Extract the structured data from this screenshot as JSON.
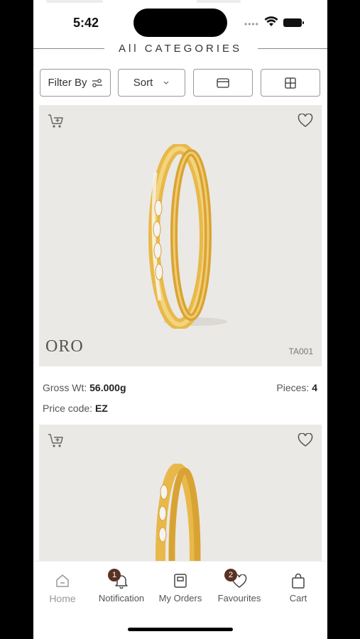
{
  "status_bar": {
    "time": "5:42"
  },
  "header": {
    "title": "All CATEGORIES"
  },
  "toolbar": {
    "filter_label": "Filter By",
    "sort_label": "Sort"
  },
  "products": [
    {
      "brand": "ORO",
      "code": "TA001",
      "gross_wt_label": "Gross Wt:",
      "gross_wt": "56.000g",
      "pieces_label": "Pieces:",
      "pieces": "4",
      "price_code_label": "Price code:",
      "price_code": "EZ"
    }
  ],
  "bottom_nav": {
    "items": [
      {
        "label": "Home",
        "icon": "home-icon",
        "active": true
      },
      {
        "label": "Notification",
        "icon": "bell-icon",
        "badge": "1"
      },
      {
        "label": "My Orders",
        "icon": "orders-icon"
      },
      {
        "label": "Favourites",
        "icon": "heart-icon",
        "badge": "2"
      },
      {
        "label": "Cart",
        "icon": "bag-icon"
      }
    ]
  },
  "colors": {
    "badge": "#5a3224",
    "card_bg": "#ebe9e6",
    "gold": "#e8b94a"
  }
}
